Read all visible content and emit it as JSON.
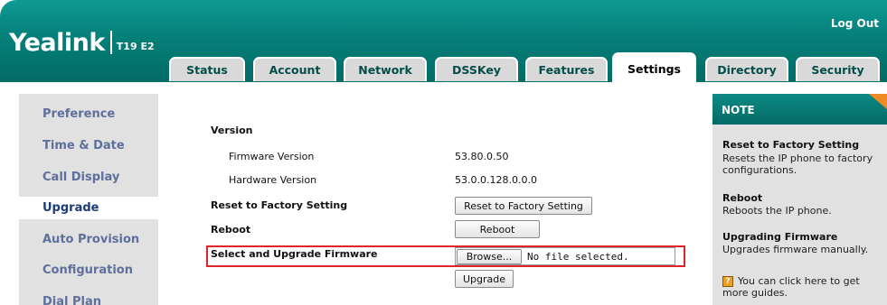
{
  "header": {
    "logo": "Yealink",
    "model": "T19 E2",
    "logout": "Log Out"
  },
  "tabs": [
    "Status",
    "Account",
    "Network",
    "DSSKey",
    "Features",
    "Settings",
    "Directory",
    "Security"
  ],
  "active_tab": "Settings",
  "sidebar": {
    "items": [
      "Preference",
      "Time & Date",
      "Call Display",
      "Upgrade",
      "Auto Provision",
      "Configuration",
      "Dial Plan"
    ],
    "active": "Upgrade"
  },
  "main": {
    "version_title": "Version",
    "firmware_label": "Firmware Version",
    "firmware_value": "53.80.0.50",
    "hardware_label": "Hardware Version",
    "hardware_value": "53.0.0.128.0.0.0",
    "reset_label": "Reset to Factory Setting",
    "reset_button": "Reset to Factory Setting",
    "reboot_label": "Reboot",
    "reboot_button": "Reboot",
    "upgrade_fw_label": "Select and Upgrade Firmware",
    "browse_button": "Browse...",
    "file_status": "No file selected.",
    "upgrade_button": "Upgrade"
  },
  "note": {
    "title": "NOTE",
    "reset_title": "Reset to Factory Setting",
    "reset_desc": "Resets the IP phone to factory configurations.",
    "reboot_title": "Reboot",
    "reboot_desc": "Reboots the IP phone.",
    "upgrading_title": "Upgrading Firmware",
    "upgrading_desc": "Upgrades firmware manually.",
    "guide_text": "You can click here to get more guides."
  },
  "colors": {
    "header_teal": "#057f79",
    "sidebar_bg": "#e1e1e1",
    "highlight_red": "#e0242a",
    "note_corner": "#f08a24"
  }
}
